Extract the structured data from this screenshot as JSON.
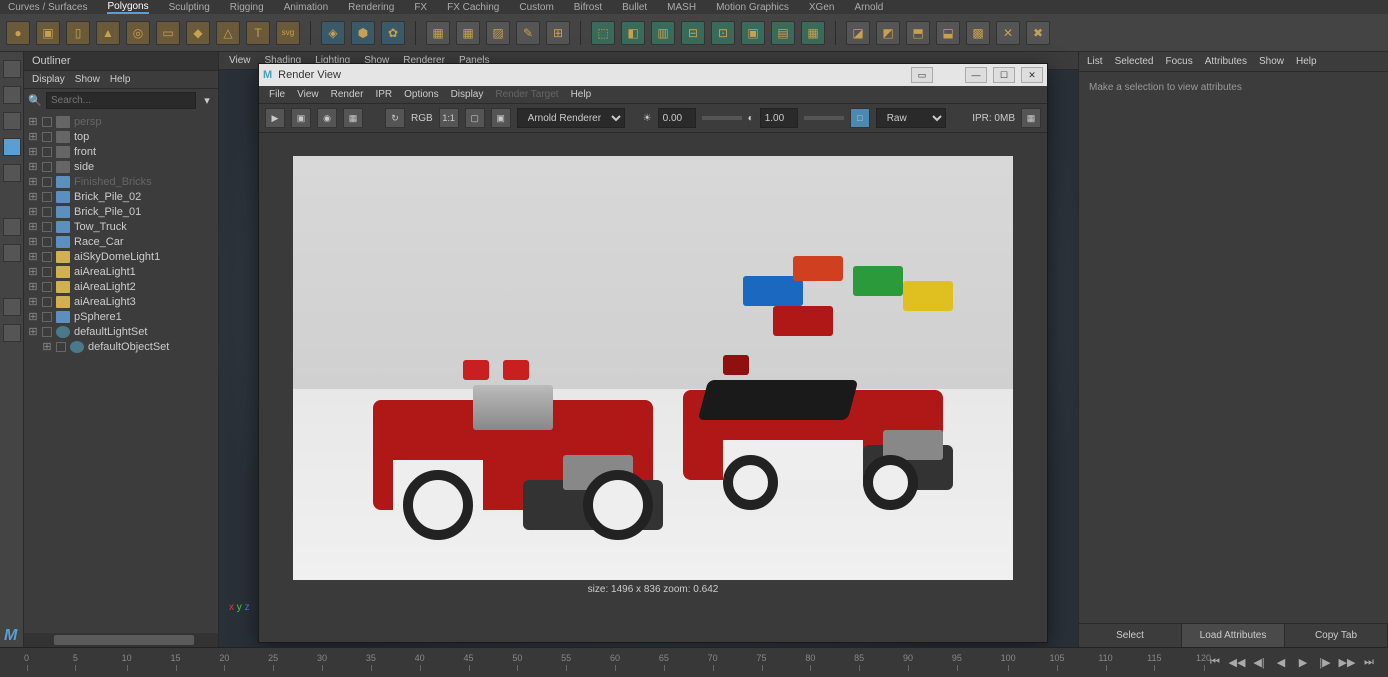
{
  "top_menu": [
    "Curves / Surfaces",
    "Polygons",
    "Sculpting",
    "Rigging",
    "Animation",
    "Rendering",
    "FX",
    "FX Caching",
    "Custom",
    "Bifrost",
    "Bullet",
    "MASH",
    "Motion Graphics",
    "XGen",
    "Arnold"
  ],
  "top_menu_active": "Polygons",
  "outliner": {
    "title": "Outliner",
    "menu": [
      "Display",
      "Show",
      "Help"
    ],
    "search_placeholder": "Search...",
    "items": [
      {
        "label": "persp",
        "type": "cam",
        "disabled": true
      },
      {
        "label": "top",
        "type": "cam"
      },
      {
        "label": "front",
        "type": "cam"
      },
      {
        "label": "side",
        "type": "cam"
      },
      {
        "label": "Finished_Bricks",
        "type": "mesh",
        "disabled": true
      },
      {
        "label": "Brick_Pile_02",
        "type": "mesh"
      },
      {
        "label": "Brick_Pile_01",
        "type": "mesh"
      },
      {
        "label": "Tow_Truck",
        "type": "mesh"
      },
      {
        "label": "Race_Car",
        "type": "mesh"
      },
      {
        "label": "aiSkyDomeLight1",
        "type": "light"
      },
      {
        "label": "aiAreaLight1",
        "type": "light"
      },
      {
        "label": "aiAreaLight2",
        "type": "light"
      },
      {
        "label": "aiAreaLight3",
        "type": "light"
      },
      {
        "label": "pSphere1",
        "type": "mesh"
      },
      {
        "label": "defaultLightSet",
        "type": "set"
      },
      {
        "label": "defaultObjectSet",
        "type": "set",
        "indent": true
      }
    ]
  },
  "viewport_menu": [
    "View",
    "Shading",
    "Lighting",
    "Show",
    "Renderer",
    "Panels"
  ],
  "render_view": {
    "title": "Render View",
    "menu": [
      "File",
      "View",
      "Render",
      "IPR",
      "Options",
      "Display",
      "Render Target",
      "Help"
    ],
    "menu_disabled": "Render Target",
    "toolbar": {
      "rgb_label": "RGB",
      "ratio": "1:1",
      "renderer": "Arnold Renderer",
      "exposure": "0.00",
      "gamma": "1.00",
      "colorspace": "Raw",
      "ipr": "IPR: 0MB"
    },
    "status": "size: 1496 x 836  zoom: 0.642"
  },
  "attr_editor": {
    "menu": [
      "List",
      "Selected",
      "Focus",
      "Attributes",
      "Show",
      "Help"
    ],
    "message": "Make a selection to view attributes",
    "tabs": [
      "Select",
      "Load Attributes",
      "Copy Tab"
    ],
    "active_tab": "Load Attributes"
  },
  "timeline": {
    "ticks": [
      0,
      5,
      10,
      15,
      20,
      25,
      30,
      35,
      40,
      45,
      50,
      55,
      60,
      65,
      70,
      75,
      80,
      85,
      90,
      95,
      100,
      105,
      110,
      115,
      120
    ]
  }
}
